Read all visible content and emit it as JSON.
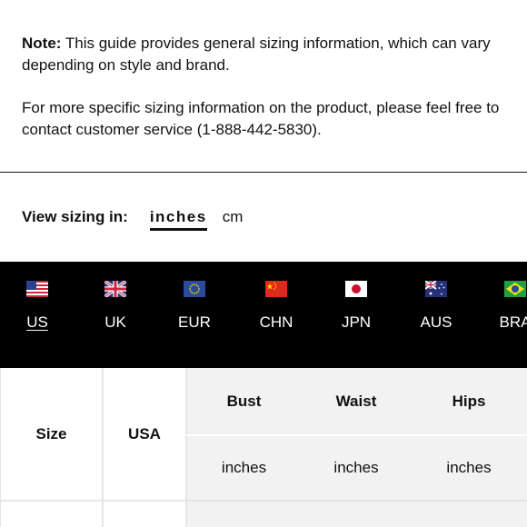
{
  "note": {
    "label": "Note:",
    "text": " This guide provides general sizing information, which can vary depending on style and brand.",
    "contact": "For more specific sizing information on the product, please feel free to contact customer service (1-888-442-5830)."
  },
  "units": {
    "label": "View sizing in:",
    "options": [
      "inches",
      "cm"
    ],
    "selected": "inches"
  },
  "countries": [
    {
      "code": "US",
      "flag": "us-flag",
      "active": true
    },
    {
      "code": "UK",
      "flag": "uk-flag"
    },
    {
      "code": "EUR",
      "flag": "eu-flag"
    },
    {
      "code": "CHN",
      "flag": "china-flag"
    },
    {
      "code": "JPN",
      "flag": "japan-flag"
    },
    {
      "code": "AUS",
      "flag": "australia-flag"
    },
    {
      "code": "BRA",
      "flag": "brazil-flag"
    }
  ],
  "table": {
    "size_header": "Size",
    "region_header": "USA",
    "measurements": [
      "Bust",
      "Waist",
      "Hips"
    ],
    "unit_row": [
      "inches",
      "inches",
      "inches"
    ]
  },
  "colors": {
    "flag_bar": "#000000",
    "light_cell": "#f2f2f2"
  }
}
